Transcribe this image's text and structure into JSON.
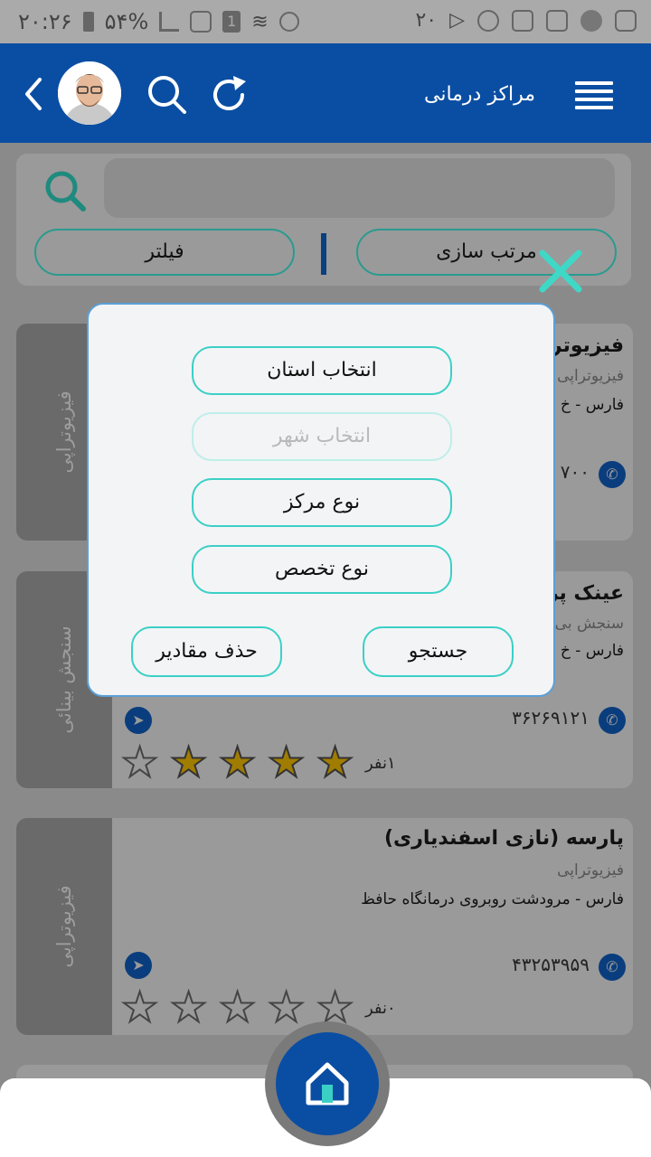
{
  "status_bar": {
    "time": "۲۰:۲۶",
    "battery": "۵۴%",
    "notif_count": "۲۰",
    "sim": "1"
  },
  "header": {
    "title": "مراکز درمانی",
    "accent": "#0a4ea3"
  },
  "filter_bar": {
    "sort_label": "مرتب سازی",
    "filter_label": "فیلتر"
  },
  "modal": {
    "province_label": "انتخاب استان",
    "city_label": "انتخاب شهر",
    "center_type_label": "نوع مرکز",
    "specialty_label": "نوع تخصص",
    "search_label": "جستجو",
    "clear_label": "حذف مقادیر"
  },
  "list": [
    {
      "side_label": "فیزیوتراپی",
      "name": "فیزیوتراپ",
      "category": "فیزیوتراپی",
      "address": "فارس - خ",
      "phone": "۷۰۰"
    },
    {
      "side_label": "سنجش بینائی",
      "name": "عینک پر",
      "category": "سنجش بی",
      "address": "فارس - خ",
      "phone": "۳۶۲۶۹۱۲۱",
      "rating": 4,
      "rating_count": "۱نفر"
    },
    {
      "side_label": "فیزیوتراپی",
      "name": "پارسه (نازی اسفندیاری)",
      "category": "فیزیوتراپی",
      "address": "فارس - مرودشت روبروی درمانگاه حافظ",
      "phone": "۴۳۲۵۳۹۵۹",
      "rating": 0,
      "rating_count": "۰نفر"
    }
  ],
  "colors": {
    "star_filled": "#a07c00",
    "teal": "#3ad0c6",
    "close_x": "#3fd8c6"
  }
}
